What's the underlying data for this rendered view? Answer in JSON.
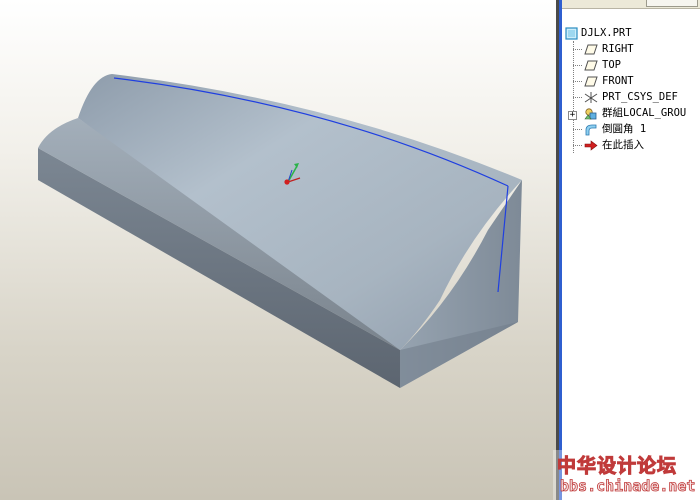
{
  "model_tree": {
    "root": {
      "label": "DJLX.PRT",
      "icon": "part-icon"
    },
    "items": [
      {
        "label": "RIGHT",
        "icon": "datum-plane-icon"
      },
      {
        "label": "TOP",
        "icon": "datum-plane-icon"
      },
      {
        "label": "FRONT",
        "icon": "datum-plane-icon"
      },
      {
        "label": "PRT_CSYS_DEF",
        "icon": "coordinate-system-icon"
      },
      {
        "label": "群組LOCAL_GROU",
        "icon": "group-icon",
        "expander": "+"
      },
      {
        "label": "倒圓角 1",
        "icon": "round-icon"
      },
      {
        "label": "在此插入",
        "icon": "insert-here-arrow-icon"
      }
    ]
  },
  "watermark": {
    "line1": "中华设计论坛",
    "line2": "bbs.chinade.net"
  },
  "colors": {
    "solid_top": "#a9b7c4",
    "solid_front": "#6e7884",
    "solid_side": "#8593a1",
    "edge_highlight": "#1f3fe0",
    "panel_border": "#2f5fd0",
    "watermark_red": "#c03a3a"
  }
}
